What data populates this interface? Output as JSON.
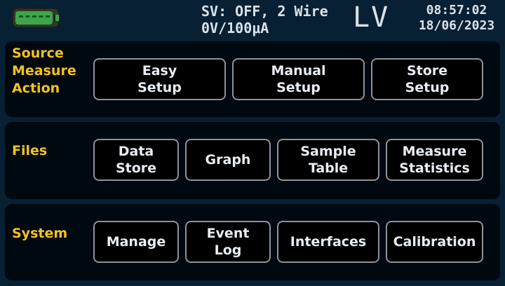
{
  "status": {
    "battery_icon": "battery-icon",
    "sv_line1": "SV: OFF, 2 Wire",
    "sv_line2": "0V/100μA",
    "mode": "LV",
    "time": "08:57:02",
    "date": "18/06/2023"
  },
  "sections": {
    "source": {
      "label": "Source\nMeasure\nAction",
      "buttons": [
        "Easy\nSetup",
        "Manual\nSetup",
        "Store\nSetup"
      ]
    },
    "files": {
      "label": "Files",
      "buttons": [
        "Data\nStore",
        "Graph",
        "Sample\nTable",
        "Measure\nStatistics"
      ]
    },
    "system": {
      "label": "System",
      "buttons": [
        "Manage",
        "Event\nLog",
        "Interfaces",
        "Calibration"
      ]
    }
  },
  "colors": {
    "background": "#082033",
    "panel": "#000810",
    "label": "#f3c419",
    "button_border": "#8e9399",
    "battery": "#3fa54a"
  }
}
